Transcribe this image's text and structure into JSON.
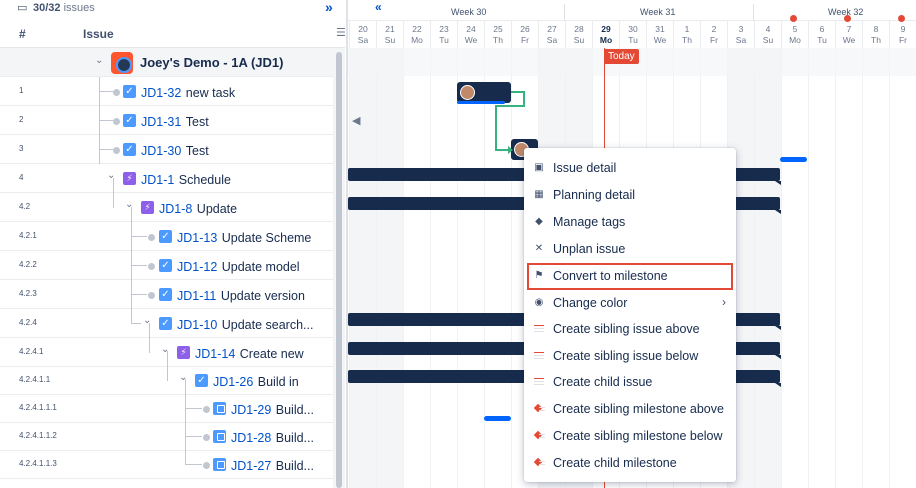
{
  "toolbar": {
    "issue_count": "30/32",
    "issue_count_suffix": "issues"
  },
  "columns": {
    "number": "#",
    "issue": "Issue"
  },
  "group": {
    "title": "Joey's Demo - 1A  (JD1)"
  },
  "rows": [
    {
      "num": "1",
      "key": "JD1-32",
      "summary": "new task"
    },
    {
      "num": "2",
      "key": "JD1-31",
      "summary": "Test"
    },
    {
      "num": "3",
      "key": "JD1-30",
      "summary": "Test"
    },
    {
      "num": "4",
      "key": "JD1-1",
      "summary": "Schedule"
    },
    {
      "num": "4.2",
      "key": "JD1-8",
      "summary": "Update"
    },
    {
      "num": "4.2.1",
      "key": "JD1-13",
      "summary": "Update Scheme"
    },
    {
      "num": "4.2.2",
      "key": "JD1-12",
      "summary": "Update model"
    },
    {
      "num": "4.2.3",
      "key": "JD1-11",
      "summary": "Update version"
    },
    {
      "num": "4.2.4",
      "key": "JD1-10",
      "summary": "Update search..."
    },
    {
      "num": "4.2.4.1",
      "key": "JD1-14",
      "summary": "Create new"
    },
    {
      "num": "4.2.4.1.1",
      "key": "JD1-26",
      "summary": "Build in"
    },
    {
      "num": "4.2.4.1.1.1",
      "key": "JD1-29",
      "summary": "Build..."
    },
    {
      "num": "4.2.4.1.1.2",
      "key": "JD1-28",
      "summary": "Build..."
    },
    {
      "num": "4.2.4.1.1.3",
      "key": "JD1-27",
      "summary": "Build..."
    }
  ],
  "timeline": {
    "weeks": [
      "Week 30",
      "Week 31",
      "Week 32"
    ],
    "days": [
      {
        "n": "20",
        "d": "Sa"
      },
      {
        "n": "21",
        "d": "Su"
      },
      {
        "n": "22",
        "d": "Mo"
      },
      {
        "n": "23",
        "d": "Tu"
      },
      {
        "n": "24",
        "d": "We"
      },
      {
        "n": "25",
        "d": "Th"
      },
      {
        "n": "26",
        "d": "Fr"
      },
      {
        "n": "27",
        "d": "Sa"
      },
      {
        "n": "28",
        "d": "Su"
      },
      {
        "n": "29",
        "d": "Mo"
      },
      {
        "n": "30",
        "d": "Tu"
      },
      {
        "n": "31",
        "d": "We"
      },
      {
        "n": "1",
        "d": "Th"
      },
      {
        "n": "2",
        "d": "Fr"
      },
      {
        "n": "3",
        "d": "Sa"
      },
      {
        "n": "4",
        "d": "Su"
      },
      {
        "n": "5",
        "d": "Mo"
      },
      {
        "n": "6",
        "d": "Tu"
      },
      {
        "n": "7",
        "d": "We"
      },
      {
        "n": "8",
        "d": "Th"
      },
      {
        "n": "9",
        "d": "Fr"
      }
    ],
    "today_label": "Today"
  },
  "context_menu": {
    "items": [
      {
        "label": "Issue detail",
        "icon": "issue-detail-icon"
      },
      {
        "label": "Planning detail",
        "icon": "calendar-icon"
      },
      {
        "label": "Manage tags",
        "icon": "tag-icon"
      },
      {
        "label": "Unplan issue",
        "icon": "close-icon"
      },
      {
        "label": "Convert to milestone",
        "icon": "flag-icon",
        "highlighted": true
      },
      {
        "label": "Change color",
        "icon": "color-icon",
        "submenu": true
      },
      {
        "label": "Create sibling issue above",
        "icon": "sibling-above-icon"
      },
      {
        "label": "Create sibling issue below",
        "icon": "sibling-below-icon"
      },
      {
        "label": "Create child issue",
        "icon": "child-issue-icon"
      },
      {
        "label": "Create sibling milestone above",
        "icon": "milestone-above-icon"
      },
      {
        "label": "Create sibling milestone below",
        "icon": "milestone-below-icon"
      },
      {
        "label": "Create child milestone",
        "icon": "child-milestone-icon"
      }
    ]
  },
  "colors": {
    "accent": "#0052cc",
    "today": "#e34935",
    "bar": "#172b4d",
    "highlight": "#e34935"
  }
}
